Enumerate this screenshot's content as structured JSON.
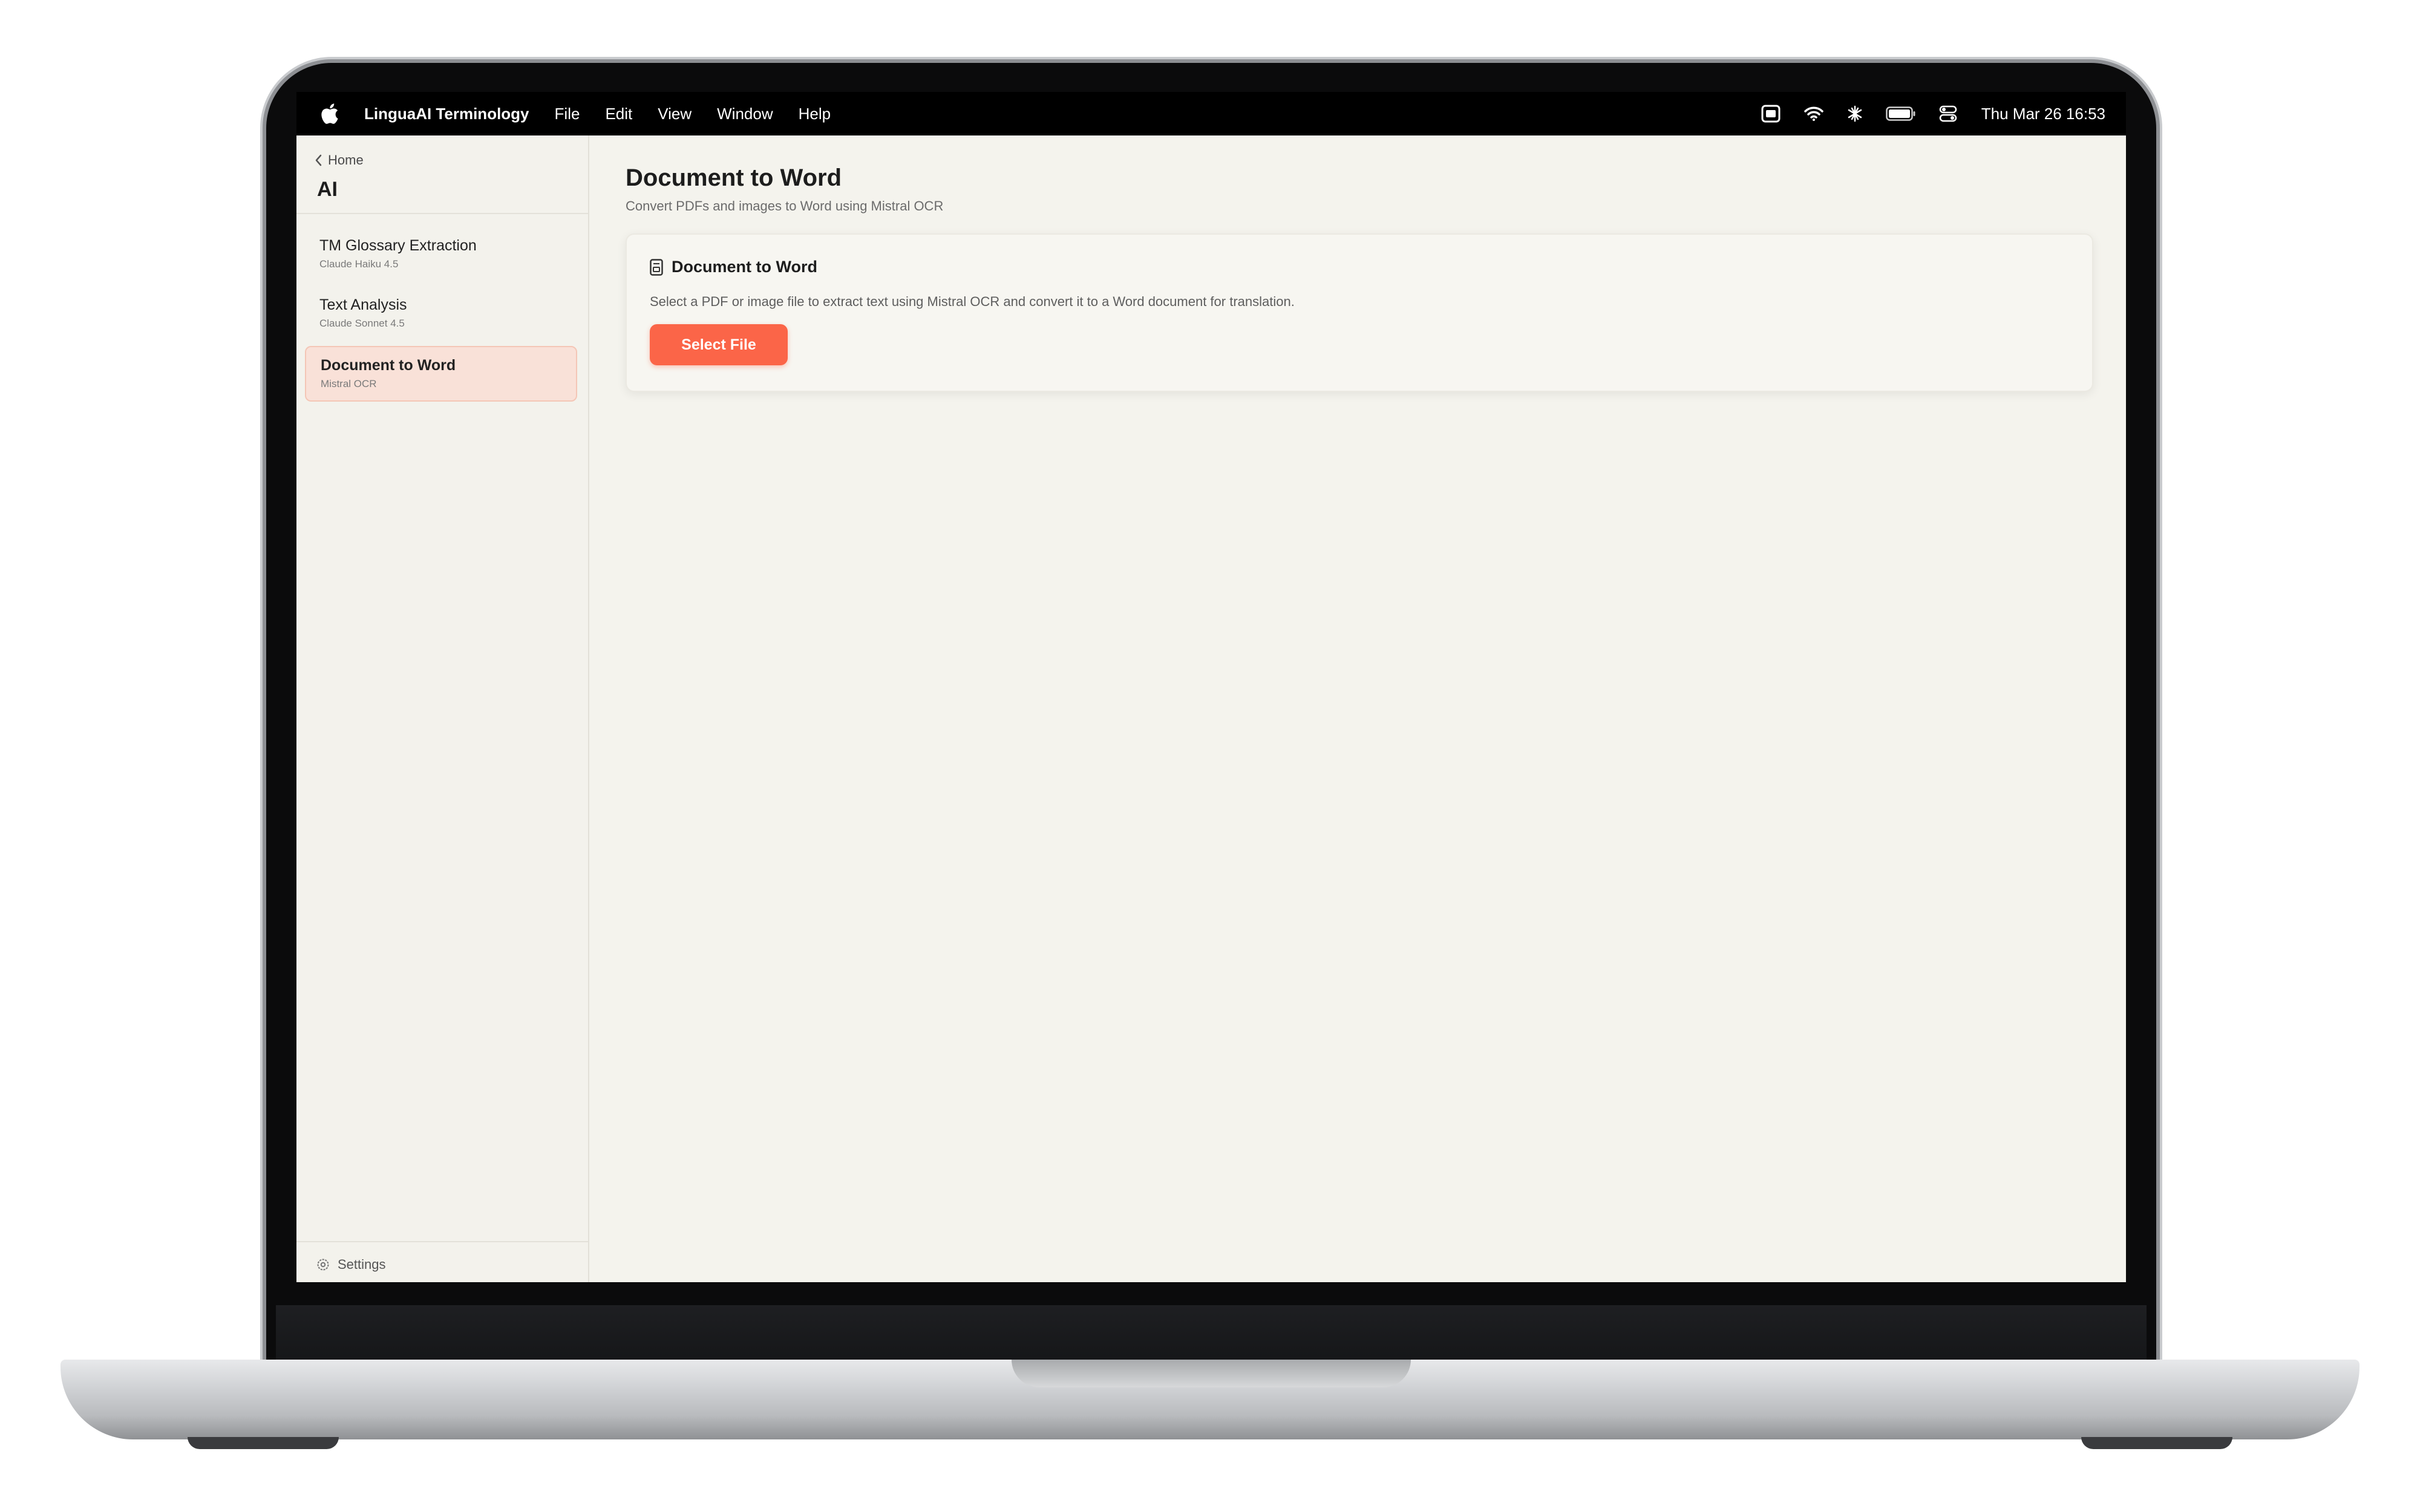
{
  "menubar": {
    "app_name": "LinguaAI Terminology",
    "menus": [
      "File",
      "Edit",
      "View",
      "Window",
      "Help"
    ],
    "clock": "Thu Mar 26  16:53",
    "status_icons": [
      "display-icon",
      "wifi-icon",
      "bluetooth-icon",
      "battery-icon",
      "control-center-icon"
    ]
  },
  "sidebar": {
    "back_label": "Home",
    "section_title": "AI",
    "items": [
      {
        "title": "TM Glossary Extraction",
        "subtitle": "Claude Haiku 4.5",
        "active": false
      },
      {
        "title": "Text Analysis",
        "subtitle": "Claude Sonnet 4.5",
        "active": false
      },
      {
        "title": "Document to Word",
        "subtitle": "Mistral OCR",
        "active": true
      }
    ],
    "settings_label": "Settings"
  },
  "main": {
    "title": "Document to Word",
    "subtitle": "Convert PDFs and images to Word using Mistral OCR",
    "card": {
      "title": "Document to Word",
      "description": "Select a PDF or image file to extract text using Mistral OCR and convert it to a Word document for translation.",
      "button_label": "Select File"
    }
  },
  "colors": {
    "accent": "#fb6548",
    "active_item_bg": "#f9e1d8",
    "background": "#f4f3ed"
  }
}
